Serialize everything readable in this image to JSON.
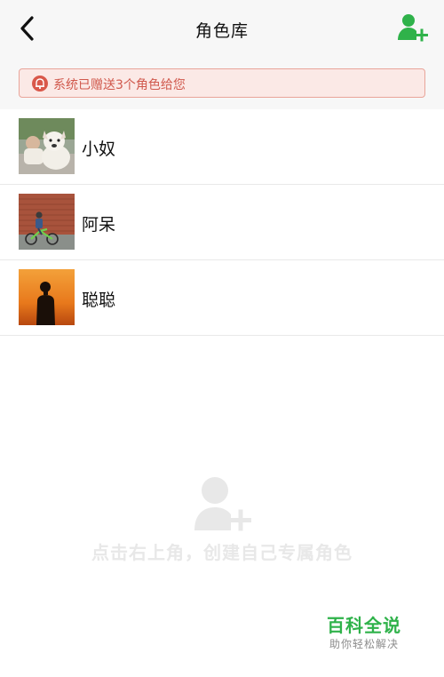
{
  "header": {
    "title": "角色库",
    "back_icon": "chevron-left-icon",
    "add_icon": "add-user-icon",
    "accent_color": "#2fb24a"
  },
  "notice": {
    "icon": "bell-icon",
    "text": "系统已赠送3个角色给您",
    "text_color": "#d0584c"
  },
  "roles": [
    {
      "name": "小奴",
      "avatar": "bulldog-photo"
    },
    {
      "name": "阿呆",
      "avatar": "cyclist-photo"
    },
    {
      "name": "聪聪",
      "avatar": "sunset-silhouette-photo"
    }
  ],
  "empty_state": {
    "icon": "add-user-icon",
    "text": "点击右上角，创建自己专属角色"
  },
  "watermark": {
    "title": "百科全说",
    "subtitle": "助你轻松解决"
  }
}
